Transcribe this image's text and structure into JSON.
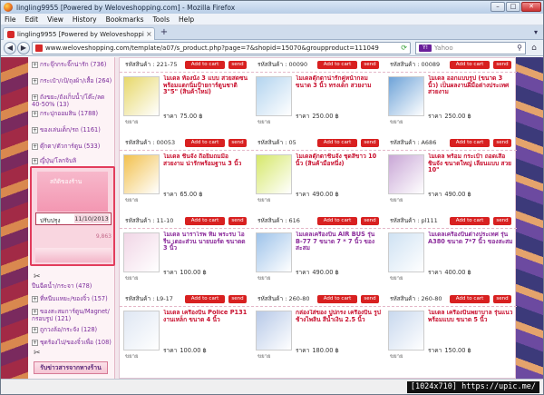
{
  "window": {
    "title": "lingling9955 [Powered by Weloveshopping.com] - Mozilla Firefox"
  },
  "menu": [
    "File",
    "Edit",
    "View",
    "History",
    "Bookmarks",
    "Tools",
    "Help"
  ],
  "tab": {
    "label": "lingling9955 [Powered by Weloveshopping.c...",
    "new_tab": "+"
  },
  "nav": {
    "url": "www.weloveshopping.com/template/a07/s_product.php?page=7&shopid=15070&groupproduct=111049",
    "search_placeholder": "Yahoo",
    "search_engine": "Y!"
  },
  "sidebar": {
    "items": [
      {
        "label": "กระจุ๊กกระจิ๊กน่ารัก (736)"
      },
      {
        "label": "กระเป๋า/เป้/ถุงผ้า/เสื้อ (264)"
      },
      {
        "label": "ถังขยะ/ถังเก็บน้ำ/โต๊ะ/ลด 40-50% (13)"
      },
      {
        "label": "กระปุกออมสิน (1788)"
      },
      {
        "label": "ของเล่นเด็ก/รถ (1161)"
      },
      {
        "label": "ตุ๊กตา/ตัวการ์ตูน (533)"
      },
      {
        "label": "ญี่ปุ่น/โลกจิบลิ"
      }
    ],
    "stats": {
      "title": "สถิติของร้าน",
      "today_label": "ปรับปรุง",
      "today_value": "11/10/2013",
      "total": "9,863"
    },
    "bottom_items": [
      {
        "label": "ปืนฉีดน้ำ/กระจา (478)"
      },
      {
        "label": "ที่หนีบแหยะ/ของจิ๋ว (157)"
      },
      {
        "label": "ของสะสมการ์ตูน/Magnet/กรอบรูป (121)"
      },
      {
        "label": "ถูกวงล้อ/กระจัง (128)"
      },
      {
        "label": "ชุดร้องไป/ของจิ๋วเพื่อ (108)"
      }
    ],
    "contact": "รับข่าวสารจากทางร้าน"
  },
  "products": {
    "sku_label": "รหัสสินค้า :",
    "cart_label": "Add to cart",
    "send_label": "send",
    "price_label": "ราคา",
    "baht": "฿",
    "zoom": "ขยาย",
    "rows": [
      {
        "top_skus": [
          "221-75",
          "00090",
          "00089"
        ],
        "items": [
          {
            "title": "โมเดล ท้องนั่ง 3 แบบ สวยสดซน พร้อมแตกนิ่มป้ายการ์ตูนชาติ 3\"5\" (สินค้าใหม่)",
            "price": "75.00",
            "thumb": "#e7d86a",
            "color": "red"
          },
          {
            "title": "โมเดลตุ๊กตาน่ารักคู่หน้ากลม ขนาด 3 นิ้ว ทรงเด็ก สวยงาม",
            "price": "250.00",
            "thumb": "#b3d4ef",
            "color": "red"
          },
          {
            "title": "โมเดล ออกแบบรูป (ขนาด 3 นิ้ว) เป็นผลงานฝีมือต่างประเทศ สวยงาม",
            "price": "250.00",
            "thumb": "#6ea3d8",
            "color": "red"
          }
        ]
      },
      {
        "top_skus": [
          "00053",
          "05",
          "A686"
        ],
        "items": [
          {
            "title": "โมเดล ชินจัง ถือยิ้มถมมือ สวยงาม น่ารักพร้อมฐาน 3 นิ้ว",
            "price": "65.00",
            "thumb": "#f2c14e",
            "color": "red"
          },
          {
            "title": "โมเดลตุ๊กตาชินจัง ชุดสีขาว 10 นิ้ว (สินค้ามือหนึ่ง)",
            "price": "490.00",
            "thumb": "#d6e86a",
            "color": "red"
          },
          {
            "title": "โมเดล พร้อม กระเป๋า ถอดเสื้อ ชินจัง ขนาดใหญ่ เลียนแบบ สวย 10\"",
            "price": "490.00",
            "thumb": "#c9a7d6",
            "color": "red"
          }
        ]
      },
      {
        "top_skus": [
          "11-10",
          "616",
          "pl111"
        ],
        "items": [
          {
            "title": "โมเดล นาราโรพ ทิม พระรบ ไอรีน เดอะส่วน นายบอร์ด ขนาดด 3 นิ้ว",
            "price": "100.00",
            "thumb": "#f1d6e6",
            "color": "purple"
          },
          {
            "title": "โมเดลเครื่องบิน AIR BUS รุ่น B-77 7 ขนาด 7 * 7 นิ้ว ของสะสม",
            "price": "490.00",
            "thumb": "#9ec3ea",
            "color": "purple"
          },
          {
            "title": "โมเดลเครื่องบินต่างประเทศ รุ่น A380 ขนาด 7*7 นิ้ว ของสะสม",
            "price": "400.00",
            "thumb": "#cfe2f3",
            "color": "purple"
          }
        ]
      },
      {
        "top_skus": [
          "L9-17",
          "260-80",
          "260-80"
        ],
        "items": [
          {
            "title": "โมเดล เครื่องบิน Police P131 งานเหล็ก ขนาด 4 นิ้ว",
            "price": "100.00",
            "thumb": "#dfe7f3",
            "color": "red"
          },
          {
            "title": "กล่องใส่ของ ปูปกรง เครื่องบิน รูปช้างไพลิน สีน้ำเงิน 2.5 นิ้ว",
            "price": "180.00",
            "thumb": "#b7c9e8",
            "color": "red"
          },
          {
            "title": "โมเดล เครื่องบินพยาบาล รุ่นแนว พร้อมแบบ ขนาด 5 นิ้ว",
            "price": "150.00",
            "thumb": "#c8d8ee",
            "color": "red"
          }
        ]
      }
    ]
  },
  "watermark": "[1024x710] https://upic.me/"
}
